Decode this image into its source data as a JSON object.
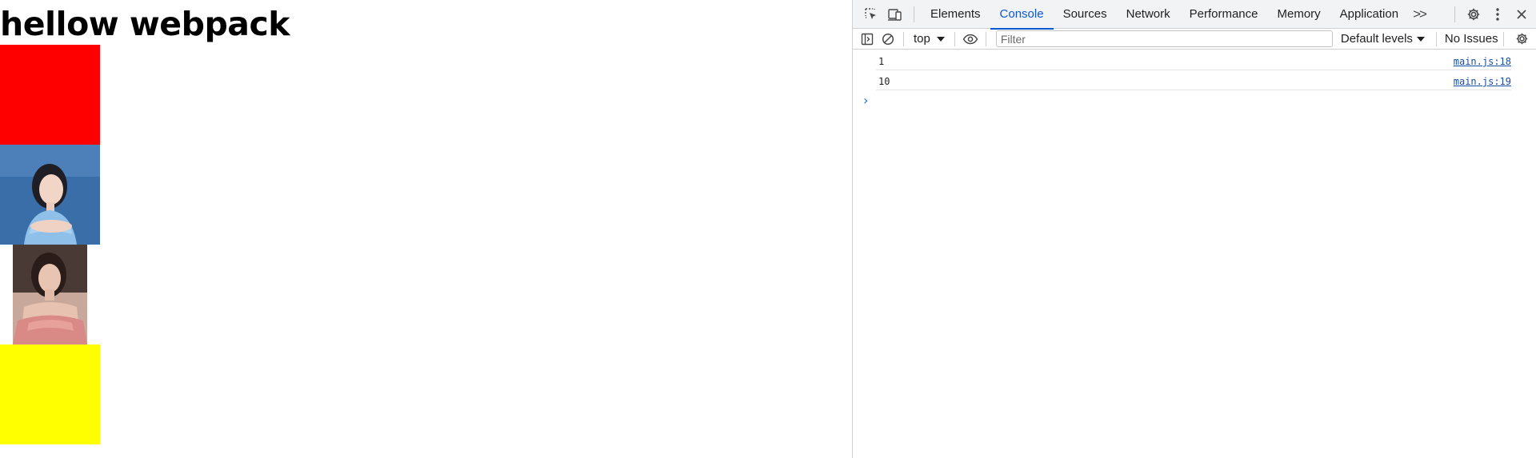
{
  "page": {
    "heading": "hellow webpack",
    "colors": {
      "red_box": "#ff0000",
      "yellow_box": "#ffff00"
    },
    "images": [
      {
        "name": "portrait-blue",
        "background": "#3a6ea8"
      },
      {
        "name": "portrait-pink",
        "background": "#4a3a36"
      }
    ]
  },
  "devtools": {
    "tabs": [
      "Elements",
      "Console",
      "Sources",
      "Network",
      "Performance",
      "Memory",
      "Application"
    ],
    "active_tab": "Console",
    "more_tabs": ">>",
    "icons": {
      "inspect": "inspect-element-icon",
      "device": "device-toolbar-icon",
      "settings": "gear-icon",
      "menu": "kebab-menu-icon",
      "close": "close-icon"
    },
    "toolbar": {
      "context": "top",
      "filter_placeholder": "Filter",
      "levels": "Default levels",
      "issues": "No Issues"
    },
    "console_messages": [
      {
        "text": "1",
        "source": "main.js:18"
      },
      {
        "text": "10",
        "source": "main.js:19"
      }
    ],
    "prompt": "›",
    "accent": "#0b57d0"
  }
}
